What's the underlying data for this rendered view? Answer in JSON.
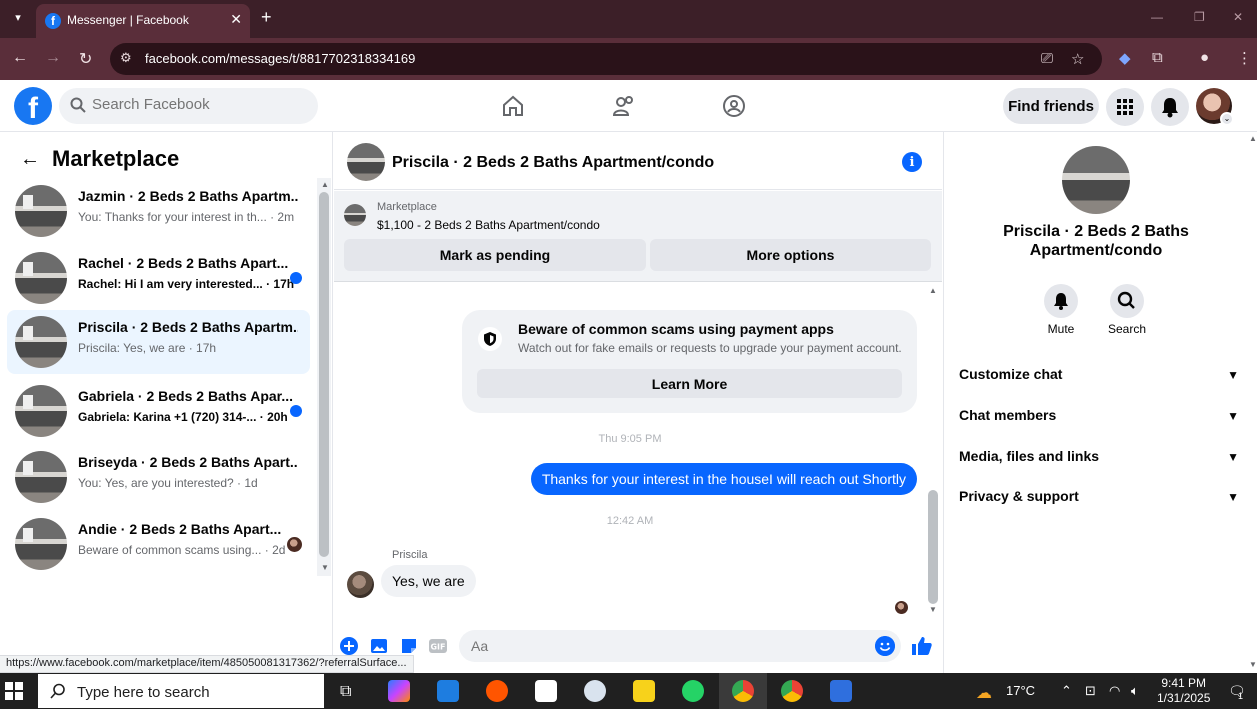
{
  "browser": {
    "tab_title": "Messenger | Facebook",
    "url": "facebook.com/messages/t/8817702318334169",
    "status_url": "https://www.facebook.com/marketplace/item/485050081317362/?referralSurface..."
  },
  "header": {
    "search_placeholder": "Search Facebook",
    "find_friends": "Find friends"
  },
  "left": {
    "title": "Marketplace",
    "conversations": [
      {
        "name": "Jazmin · 2 Beds 2 Baths Apartm...",
        "preview": "You: Thanks for your interest in th... · 2m",
        "unread": false
      },
      {
        "name": "Rachel · 2 Beds 2 Baths Apart...",
        "preview": "Rachel: Hi I am very interested... · 17h",
        "unread": true
      },
      {
        "name": "Priscila · 2 Beds 2 Baths Apartm...",
        "preview": "Priscila: Yes, we are · 17h",
        "unread": false
      },
      {
        "name": "Gabriela · 2 Beds 2 Baths Apar...",
        "preview": "Gabriela: Karina +1 (720) 314-... · 20h",
        "unread": true
      },
      {
        "name": "Briseyda · 2 Beds 2 Baths Apart...",
        "preview": "You: Yes, are you interested? · 1d",
        "unread": false
      },
      {
        "name": "Andie · 2 Beds 2 Baths Apart...",
        "preview": "Beware of common scams using... · 2d",
        "unread": false
      }
    ]
  },
  "chat": {
    "title": "Priscila · 2 Beds 2 Baths Apartment/condo",
    "marketplace_label": "Marketplace",
    "listing": "$1,100 - 2 Beds 2 Baths Apartment/condo",
    "mark_pending": "Mark as pending",
    "more_options": "More options",
    "scam_title": "Beware of common scams using payment apps",
    "scam_sub": "Watch out for fake emails or requests to upgrade your payment account.",
    "learn_more": "Learn More",
    "ts1": "Thu 9:05 PM",
    "outgoing": "Thanks for your interest in the houseI will reach out Shortly",
    "ts2": "12:42 AM",
    "sender": "Priscila",
    "incoming": "Yes, we are",
    "composer_placeholder": "Aa"
  },
  "right": {
    "title": "Priscila · 2 Beds 2 Baths Apartment/condo",
    "mute": "Mute",
    "search": "Search",
    "rows": [
      "Customize chat",
      "Chat members",
      "Media, files and links",
      "Privacy & support"
    ]
  },
  "taskbar": {
    "search_text": "Type here to search",
    "temp": "17°C",
    "time": "9:41 PM",
    "date": "1/31/2025",
    "notif_count": "1"
  },
  "colors": {
    "brand": "#1877f2",
    "accent": "#0866ff",
    "chrome": "#5a2e3a"
  }
}
